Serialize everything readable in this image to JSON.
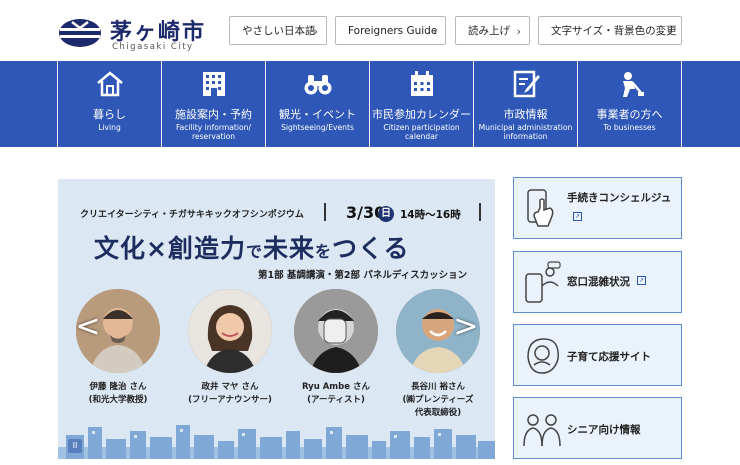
{
  "header": {
    "logo_title": "茅ヶ崎市",
    "logo_sub": "Chigasaki City",
    "buttons": [
      {
        "label": "やさしい日本語"
      },
      {
        "label": "Foreigners Guide"
      },
      {
        "label": "読み上げ"
      },
      {
        "label": "文字サイズ・背景色の変更"
      }
    ]
  },
  "nav": {
    "items": [
      {
        "jp": "暮らし",
        "en": "Living",
        "icon": "house-icon"
      },
      {
        "jp": "施設案内・予約",
        "en": "Facility information/ reservation",
        "icon": "building-icon"
      },
      {
        "jp": "観光・イベント",
        "en": "Sightseeing/Events",
        "icon": "binoculars-icon"
      },
      {
        "jp": "市民参加カレンダー",
        "en": "Citizen participation calendar",
        "icon": "calendar-icon"
      },
      {
        "jp": "市政情報",
        "en": "Municipal administration information",
        "icon": "document-pen-icon"
      },
      {
        "jp": "事業者の方へ",
        "en": "To businesses",
        "icon": "worker-icon"
      }
    ]
  },
  "banner": {
    "top_text": "クリエイターシティ・チガサキキックオフシンポジウム",
    "date": "3/30",
    "day": "日",
    "time": "14時〜16時",
    "headline_1": "文化",
    "headline_x": "×",
    "headline_2": "創造力",
    "headline_3": "で",
    "headline_4": "未来",
    "headline_5": "を",
    "headline_6": "つくる",
    "sub": "第1部 基調講演・第2部 パネルディスカッション",
    "speakers": [
      {
        "name": "伊藤 隆治 さん",
        "role": "(和光大学教授)"
      },
      {
        "name": "政井 マヤ さん",
        "role": "(フリーアナウンサー)"
      },
      {
        "name": "Ryu Ambe さん",
        "role": "(アーティスト)"
      },
      {
        "name": "長谷川 裕さん",
        "role": "(㈱プレンティーズ",
        "role2": "代表取締役)"
      }
    ],
    "prev": "<",
    "next": ">",
    "pause": "II"
  },
  "side": {
    "cards": [
      {
        "title": "手続きコンシェルジュ",
        "icon": "smartphone-tap-icon"
      },
      {
        "title": "窓口混雑状況",
        "icon": "phone-chat-icon"
      },
      {
        "title": "子育て応援サイト",
        "icon": "baby-icon"
      },
      {
        "title": "シニア向け情報",
        "icon": "seniors-icon"
      }
    ]
  },
  "colors": {
    "nav_bg": "#2f57b7",
    "brand_navy": "#1c2a6b",
    "card_bg": "#eaf2fb",
    "card_border": "#5f8ed0"
  }
}
